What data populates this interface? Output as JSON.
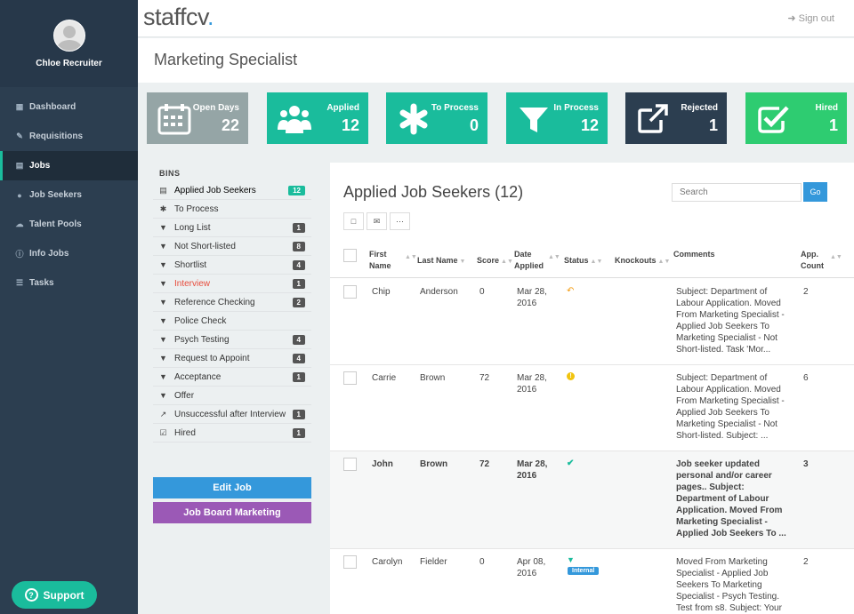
{
  "profile": {
    "name": "Chloe Recruiter"
  },
  "nav": [
    {
      "label": "Dashboard",
      "icon": "dashboard-icon"
    },
    {
      "label": "Requisitions",
      "icon": "edit-icon"
    },
    {
      "label": "Jobs",
      "icon": "document-icon"
    },
    {
      "label": "Job Seekers",
      "icon": "users-icon"
    },
    {
      "label": "Talent Pools",
      "icon": "cloud-icon"
    },
    {
      "label": "Info Jobs",
      "icon": "info-icon"
    },
    {
      "label": "Tasks",
      "icon": "list-icon"
    }
  ],
  "support_label": "Support",
  "header": {
    "logo": "staffcv",
    "signout": "Sign out"
  },
  "page_title": "Marketing Specialist",
  "stats": [
    {
      "label": "Open Days",
      "value": "22",
      "color": "#95a5a6",
      "icon": "calendar-icon"
    },
    {
      "label": "Applied",
      "value": "12",
      "color": "#1abc9c",
      "icon": "people-icon"
    },
    {
      "label": "To Process",
      "value": "0",
      "color": "#1abc9c",
      "icon": "asterisk-icon"
    },
    {
      "label": "In Process",
      "value": "12",
      "color": "#1abc9c",
      "icon": "filter-icon"
    },
    {
      "label": "Rejected",
      "value": "1",
      "color": "#2c3e50",
      "icon": "external-link-icon"
    },
    {
      "label": "Hired",
      "value": "1",
      "color": "#2ecc71",
      "icon": "check-square-icon"
    }
  ],
  "bins": {
    "title": "BINS",
    "items": [
      {
        "label": "Applied Job Seekers",
        "count": "12",
        "icon": "inbox-icon"
      },
      {
        "label": "To Process",
        "count": "",
        "icon": "asterisk-icon"
      },
      {
        "label": "Long List",
        "count": "1",
        "icon": "filter-icon"
      },
      {
        "label": "Not Short-listed",
        "count": "8",
        "icon": "filter-icon"
      },
      {
        "label": "Shortlist",
        "count": "4",
        "icon": "filter-icon"
      },
      {
        "label": "Interview",
        "count": "1",
        "icon": "filter-icon"
      },
      {
        "label": "Reference Checking",
        "count": "2",
        "icon": "filter-icon"
      },
      {
        "label": "Police Check",
        "count": "",
        "icon": "filter-icon"
      },
      {
        "label": "Psych Testing",
        "count": "4",
        "icon": "filter-icon"
      },
      {
        "label": "Request to Appoint",
        "count": "4",
        "icon": "filter-icon"
      },
      {
        "label": "Acceptance",
        "count": "1",
        "icon": "filter-icon"
      },
      {
        "label": "Offer",
        "count": "",
        "icon": "filter-icon"
      },
      {
        "label": "Unsuccessful after Interview",
        "count": "1",
        "icon": "external-link-icon"
      },
      {
        "label": "Hired",
        "count": "1",
        "icon": "check-square-icon"
      }
    ]
  },
  "buttons": {
    "edit_job": "Edit Job",
    "job_board": "Job Board Marketing"
  },
  "panel": {
    "title": "Applied Job Seekers (12)",
    "search_placeholder": "Search",
    "go": "Go",
    "columns": {
      "first_name": "First Name",
      "last_name": "Last Name",
      "score": "Score",
      "date_applied": "Date Applied",
      "status": "Status",
      "knockouts": "Knockouts",
      "comments": "Comments",
      "app_count": "App. Count"
    },
    "rows": [
      {
        "first": "Chip",
        "last": "Anderson",
        "score": "0",
        "date": "Mar 28, 2016",
        "status": "undo-icon",
        "status_color": "#f39c12",
        "tag": "",
        "comments": "Subject: Department of Labour Application. Moved From Marketing Specialist - Applied Job Seekers To Marketing Specialist - Not Short-listed. Task 'Mor...",
        "count": "2"
      },
      {
        "first": "Carrie",
        "last": "Brown",
        "score": "72",
        "date": "Mar 28, 2016",
        "status": "alert-icon",
        "status_color": "#f1c40f",
        "tag": "",
        "comments": "Subject: Department of Labour Application. Moved From Marketing Specialist - Applied Job Seekers To Marketing Specialist - Not Short-listed. Subject: ...",
        "count": "6"
      },
      {
        "first": "John",
        "last": "Brown",
        "score": "72",
        "date": "Mar 28, 2016",
        "status": "check-icon",
        "status_color": "#1abc9c",
        "tag": "",
        "comments": "Job seeker updated personal and/or career pages.. Subject: Department of Labour Application. Moved From Marketing Specialist - Applied Job Seekers To ...",
        "count": "3"
      },
      {
        "first": "Carolyn",
        "last": "Fielder",
        "score": "0",
        "date": "Apr 08, 2016",
        "status": "filter-icon",
        "status_color": "#1abc9c",
        "tag": "Internal",
        "comments": "Moved From Marketing Specialist - Applied Job Seekers To Marketing Specialist - Psych Testing. Test from s8. Subject: Your",
        "count": "2"
      }
    ]
  }
}
